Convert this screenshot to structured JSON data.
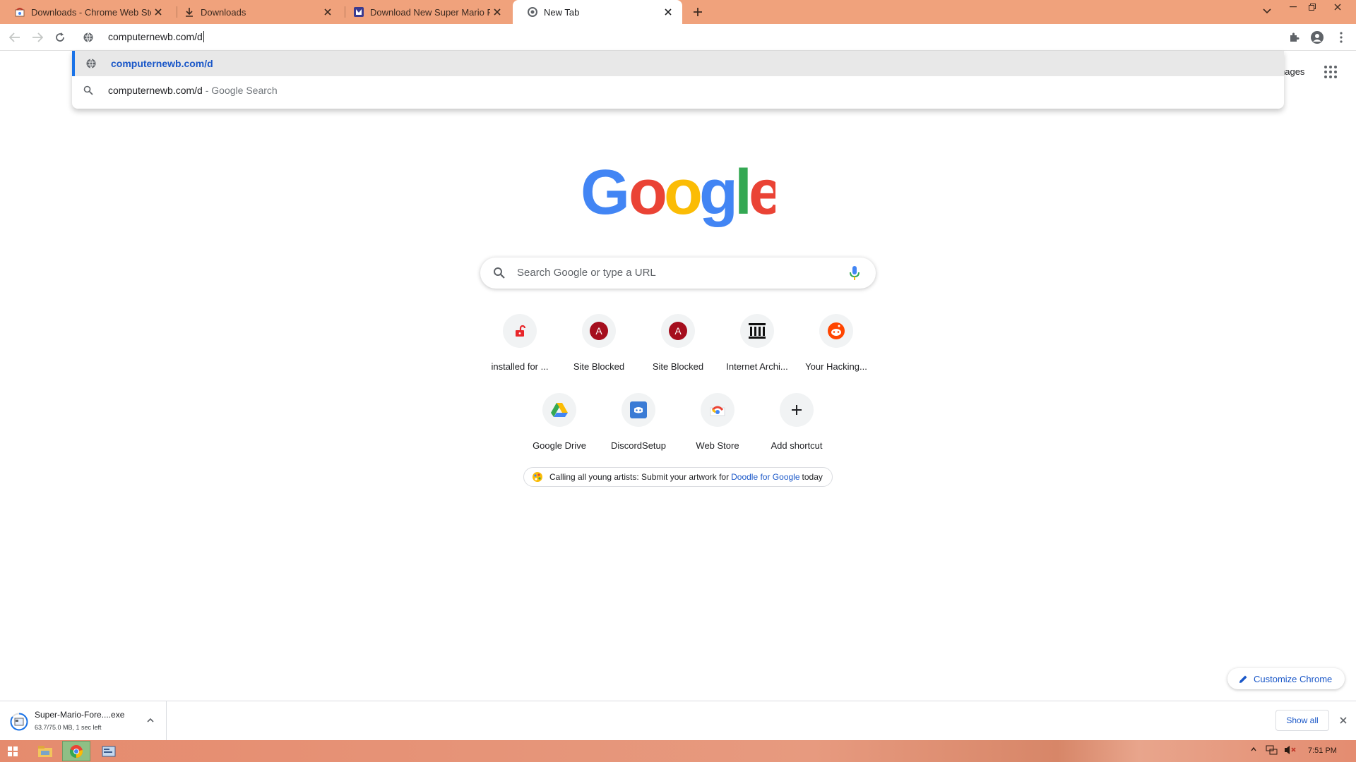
{
  "tabs": [
    {
      "title": "Downloads - Chrome Web Store",
      "icon": "chrome-web-store-icon"
    },
    {
      "title": "Downloads",
      "icon": "download-icon"
    },
    {
      "title": "Download New Super Mario Fore",
      "icon": "site-favicon"
    },
    {
      "title": "New Tab",
      "icon": "chrome-icon",
      "active": true
    }
  ],
  "omnibox": {
    "value": "computernewb.com/d"
  },
  "suggestions": [
    {
      "text": "computernewb.com/d",
      "sub": "",
      "icon": "globe-icon"
    },
    {
      "text": "computernewb.com/d",
      "sub": " - Google Search",
      "icon": "search-icon"
    }
  ],
  "header": {
    "images_link": "nages"
  },
  "search": {
    "placeholder": "Search Google or type a URL"
  },
  "shortcuts": [
    {
      "label": "installed for ...",
      "icon": "unlock-icon"
    },
    {
      "label": "Site Blocked",
      "icon": "letter-a-icon",
      "letter": "A"
    },
    {
      "label": "Site Blocked",
      "icon": "letter-a-icon",
      "letter": "A"
    },
    {
      "label": "Internet Archi...",
      "icon": "archive-icon"
    },
    {
      "label": "Your Hacking...",
      "icon": "reddit-icon"
    },
    {
      "label": "Google Drive",
      "icon": "drive-icon"
    },
    {
      "label": "DiscordSetup",
      "icon": "discord-icon"
    },
    {
      "label": "Web Store",
      "icon": "web-store-icon"
    },
    {
      "label": "Add shortcut",
      "icon": "plus-icon"
    }
  ],
  "promo": {
    "before": "Calling all young artists: Submit your artwork for",
    "link": "Doodle for Google",
    "after": "today"
  },
  "customize": {
    "label": "Customize Chrome"
  },
  "download": {
    "name": "Super-Mario-Fore....exe",
    "status": "63.7/75.0 MB, 1 sec left"
  },
  "shelf": {
    "show_all": "Show all"
  },
  "taskbar": {
    "time": "7:51 PM"
  },
  "colors": {
    "tab_strip": "#f0a27c",
    "accent": "#1a73e8",
    "link": "#1a57c8"
  }
}
